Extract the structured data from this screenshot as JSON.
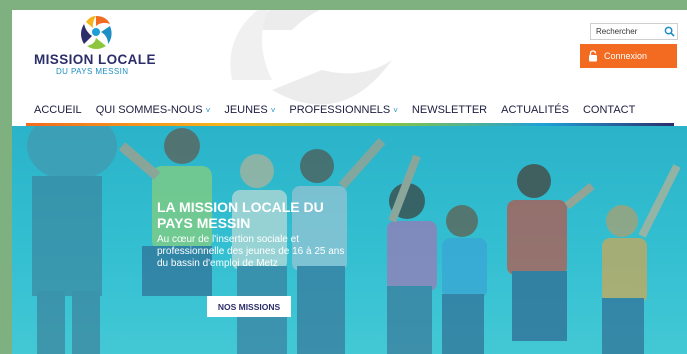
{
  "header": {
    "brand_title": "MISSION LOCALE",
    "brand_subtitle": "DU PAYS MESSIN",
    "search": {
      "placeholder": "Rechercher"
    },
    "login_label": "Connexion"
  },
  "nav": {
    "items": [
      {
        "label": "ACCUEIL",
        "has_dropdown": false
      },
      {
        "label": "QUI SOMMES-NOUS",
        "has_dropdown": true
      },
      {
        "label": "JEUNES",
        "has_dropdown": true
      },
      {
        "label": "PROFESSIONNELS",
        "has_dropdown": true
      },
      {
        "label": "NEWSLETTER",
        "has_dropdown": false
      },
      {
        "label": "ACTUALITÉS",
        "has_dropdown": false
      },
      {
        "label": "CONTACT",
        "has_dropdown": false
      }
    ],
    "dropdown_glyph": "˅"
  },
  "hero": {
    "title": "LA MISSION LOCALE DU PAYS MESSIN",
    "text": "Au cœur de l'insertion sociale et professionnelle des jeunes de 16 à 25 ans du bassin d'emploi de Metz",
    "cta_label": "NOS MISSIONS"
  },
  "colors": {
    "accent": "#f26b21",
    "brand_navy": "#2c2e6a",
    "brand_blue": "#1e8fc4",
    "hero_bg": "#35c0d2"
  },
  "icons": [
    "logo-mark-icon",
    "search-icon",
    "lock-icon",
    "chevron-down-icon"
  ]
}
